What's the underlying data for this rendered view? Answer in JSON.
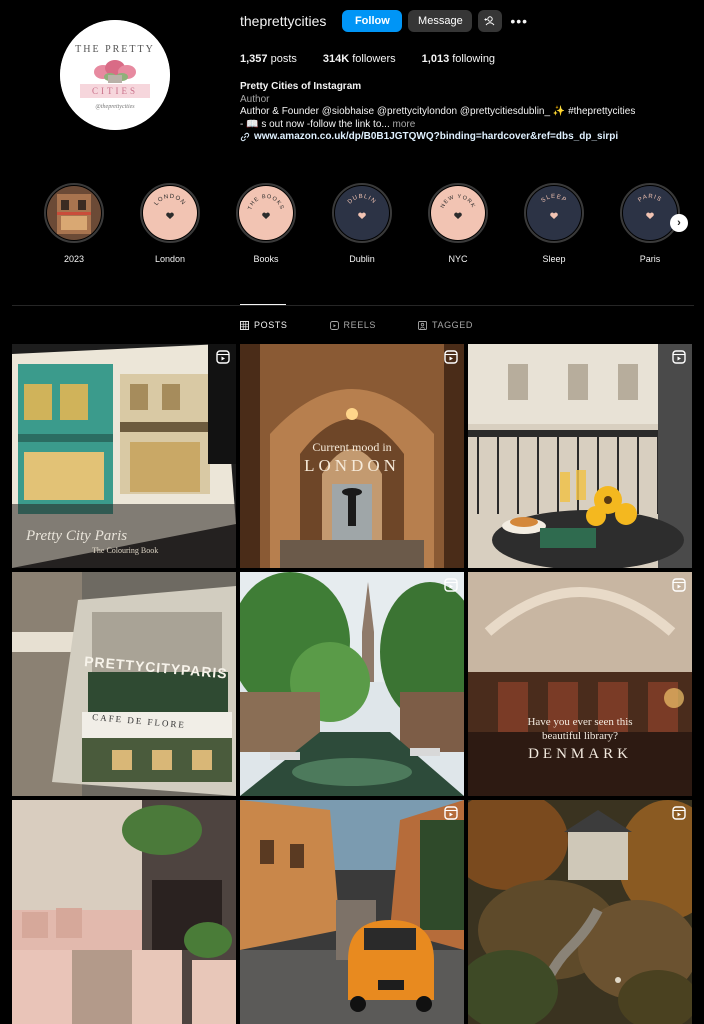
{
  "profile": {
    "username": "theprettycities",
    "follow_label": "Follow",
    "message_label": "Message",
    "avatar_top_text": "THE PRETTY",
    "avatar_bottom_text": "CITIES",
    "avatar_sub_text": "@theprettycities"
  },
  "stats": {
    "posts_count": "1,357",
    "posts_label": "posts",
    "followers_count": "314K",
    "followers_label": "followers",
    "following_count": "1,013",
    "following_label": "following"
  },
  "bio": {
    "name": "Pretty Cities of Instagram",
    "category": "Author",
    "line1": "Author & Founder @siobhaise @prettycitylondon @prettycitiesdublin_ ✨ #theprettycities",
    "line2": "- 📖 s out now -follow the link to...",
    "more": "more",
    "link": "www.amazon.co.uk/dp/B0B1JGTQWQ?binding=hardcover&ref=dbs_dp_sirpi"
  },
  "highlights": [
    {
      "label": "2023",
      "inner_text": "",
      "color": "#6b4a36"
    },
    {
      "label": "London",
      "inner_text": "LONDON",
      "color": "#f2c4b3"
    },
    {
      "label": "Books",
      "inner_text": "THE BOOKS",
      "color": "#f2c4b3"
    },
    {
      "label": "Dublin",
      "inner_text": "DUBLIN",
      "color": "#2c3345"
    },
    {
      "label": "NYC",
      "inner_text": "NEW YORK",
      "color": "#f2c4b3"
    },
    {
      "label": "Sleep",
      "inner_text": "SLEEP",
      "color": "#2c3345"
    },
    {
      "label": "Paris",
      "inner_text": "PARIS",
      "color": "#2c3345"
    }
  ],
  "tabs": {
    "posts": "POSTS",
    "reels": "REELS",
    "tagged": "TAGGED"
  },
  "posts": [
    {
      "overlay_line1": "Pretty City Paris",
      "overlay_line2": "The Colouring Book"
    },
    {
      "overlay_line1": "Current mood in",
      "overlay_line2": "LONDON"
    },
    {
      "overlay_line1": "",
      "overlay_line2": ""
    },
    {
      "overlay_line1": "PRETTYCITYPARIS",
      "overlay_line2": "CAFE DE FLORE"
    },
    {
      "overlay_line1": "",
      "overlay_line2": ""
    },
    {
      "overlay_line1": "Have you ever seen this",
      "overlay_line2": "beautiful library?",
      "overlay_line3": "DENMARK"
    },
    {
      "overlay_line1": "",
      "overlay_line2": ""
    },
    {
      "overlay_line1": "",
      "overlay_line2": ""
    },
    {
      "overlay_line1": "",
      "overlay_line2": ""
    }
  ],
  "colors": {
    "follow_blue": "#0095f6",
    "button_gray": "#363636",
    "highlight_pink": "#f2c4b3",
    "highlight_navy": "#2c3345"
  }
}
